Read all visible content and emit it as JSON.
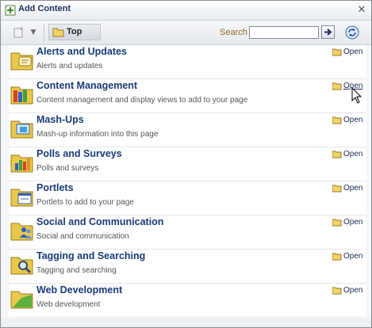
{
  "window": {
    "title": "Add Content",
    "close_icon": "close-icon"
  },
  "toolbar": {
    "breadcrumb": "Top",
    "search_label": "Search",
    "search_value": "",
    "search_placeholder": ""
  },
  "open_label": "Open",
  "items": [
    {
      "title": "Alerts and Updates",
      "description": "Alerts and updates",
      "icon": "folder-alerts-icon"
    },
    {
      "title": "Content Management",
      "description": "Content management and display views to add to your page",
      "icon": "folder-content-icon"
    },
    {
      "title": "Mash-Ups",
      "description": "Mash-up information into this page",
      "icon": "folder-mashup-icon"
    },
    {
      "title": "Polls and Surveys",
      "description": "Polls and surveys",
      "icon": "folder-polls-icon"
    },
    {
      "title": "Portlets",
      "description": "Portlets to add to your page",
      "icon": "folder-portlets-icon"
    },
    {
      "title": "Social and Communication",
      "description": "Social and communication",
      "icon": "folder-social-icon"
    },
    {
      "title": "Tagging and Searching",
      "description": "Tagging and searching",
      "icon": "folder-tagging-icon"
    },
    {
      "title": "Web Development",
      "description": "Web development",
      "icon": "folder-webdev-icon"
    }
  ],
  "colors": {
    "title_text": "#1a3a78",
    "folder": "#e8c94a",
    "search_label": "#8a6d1a"
  }
}
